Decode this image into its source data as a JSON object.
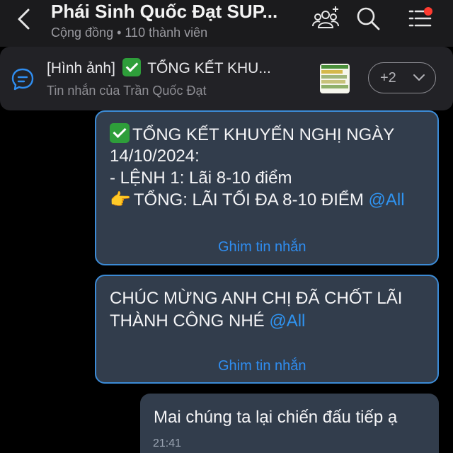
{
  "header": {
    "title": "Phái Sinh Quốc Đạt SUP...",
    "subtitle": "Cộng đồng • 110 thành viên"
  },
  "pinned": {
    "prefix": "[Hình ảnh]",
    "title": "TỔNG KẾT KHU...",
    "sender": "Tin nhắn của Trần Quốc Đạt",
    "more_count": "+2"
  },
  "messages": [
    {
      "line1": "TỔNG KẾT KHUYẾN NGHỊ NGÀY",
      "line2": "14/10/2024:",
      "line3": "- LỆNH 1: Lãi 8-10 điểm",
      "line4": "TỔNG: LÃI TỐI ĐA 8-10 ĐIỂM",
      "mention": "@All",
      "pin_label": "Ghim tin nhắn"
    },
    {
      "line1": "CHÚC MỪNG ANH CHỊ ĐÃ CHỐT LÃI",
      "line2": "THÀNH CÔNG NHÉ",
      "mention": "@All",
      "pin_label": "Ghim tin nhắn"
    },
    {
      "text": "Mai chúng ta lại chiến đấu tiếp ạ",
      "time": "21:41"
    }
  ],
  "icons": {
    "back": "chevron-left-icon",
    "add_member": "add-member-icon",
    "search": "search-icon",
    "menu": "menu-icon",
    "pinned": "chat-bubble-icon"
  },
  "colors": {
    "accent": "#2f8df0",
    "bubble": "#323d4c",
    "bubble_border": "#3c8bd6",
    "notification": "#ff3b30"
  }
}
